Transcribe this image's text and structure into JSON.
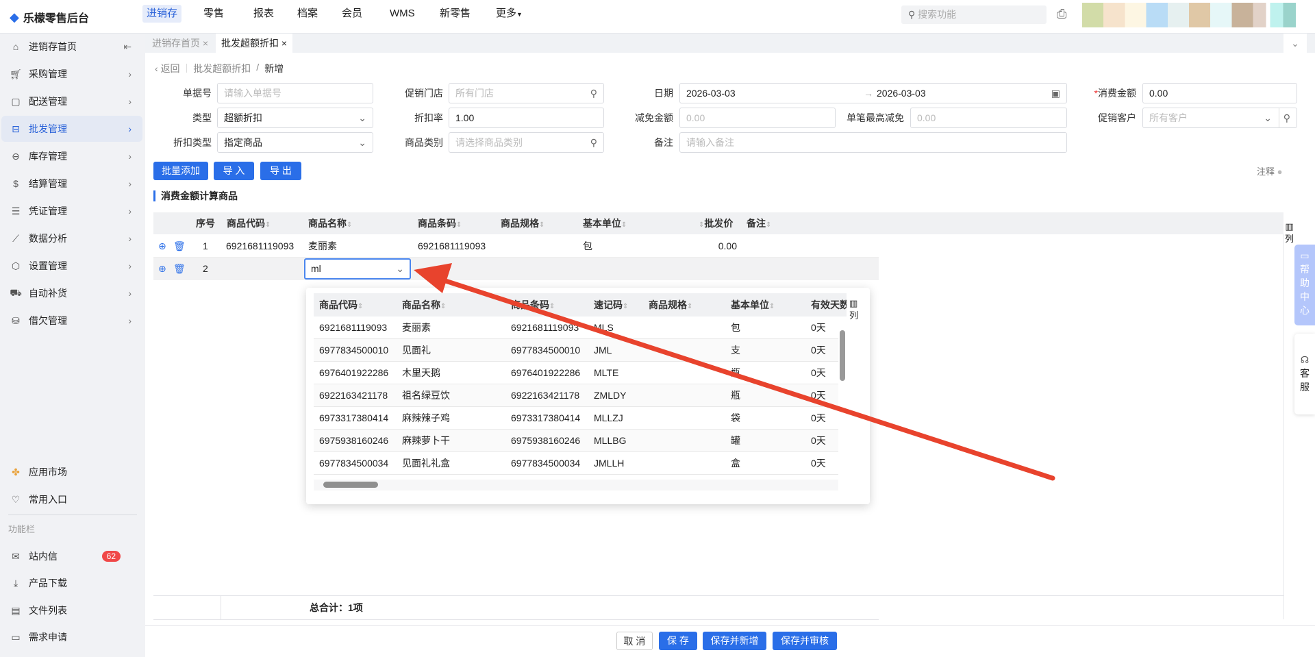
{
  "app": {
    "title": "乐檬零售后台"
  },
  "topnav": [
    {
      "label": "进销存",
      "active": true
    },
    {
      "label": "零售"
    },
    {
      "label": "报表"
    },
    {
      "label": "档案"
    },
    {
      "label": "会员"
    },
    {
      "label": "WMS"
    },
    {
      "label": "新零售"
    },
    {
      "label": "更多"
    }
  ],
  "search": {
    "placeholder": "搜索功能"
  },
  "sidebar": {
    "items": [
      {
        "label": "进销存首页"
      },
      {
        "label": "采购管理"
      },
      {
        "label": "配送管理"
      },
      {
        "label": "批发管理",
        "active": true
      },
      {
        "label": "库存管理"
      },
      {
        "label": "结算管理"
      },
      {
        "label": "凭证管理"
      },
      {
        "label": "数据分析"
      },
      {
        "label": "设置管理"
      },
      {
        "label": "自动补货"
      },
      {
        "label": "借欠管理"
      }
    ],
    "bottom": [
      {
        "label": "应用市场"
      },
      {
        "label": "常用入口"
      }
    ],
    "section_label": "功能栏",
    "tools": [
      {
        "label": "站内信",
        "badge": "62"
      },
      {
        "label": "产品下载"
      },
      {
        "label": "文件列表"
      },
      {
        "label": "需求申请"
      }
    ]
  },
  "tabs": [
    {
      "label": "进销存首页"
    },
    {
      "label": "批发超额折扣",
      "active": true
    }
  ],
  "breadcrumb": {
    "back": "返回",
    "parent": "批发超额折扣",
    "current": "新增"
  },
  "form": {
    "doc_no": {
      "label": "单据号",
      "placeholder": "请输入单据号"
    },
    "store": {
      "label": "促销门店",
      "placeholder": "所有门店"
    },
    "date": {
      "label": "日期",
      "start": "2026-03-03",
      "end": "2026-03-03"
    },
    "amount": {
      "label": "消费金额",
      "value": "0.00",
      "required": "*"
    },
    "type": {
      "label": "类型",
      "value": "超额折扣"
    },
    "rate": {
      "label": "折扣率",
      "value": "1.00"
    },
    "reduce": {
      "label": "减免金额",
      "placeholder": "0.00"
    },
    "max_reduce": {
      "label": "单笔最高减免",
      "placeholder": "0.00"
    },
    "customer": {
      "label": "促销客户",
      "placeholder": "所有客户"
    },
    "discount_type": {
      "label": "折扣类型",
      "value": "指定商品"
    },
    "category": {
      "label": "商品类别",
      "placeholder": "请选择商品类别"
    },
    "remark": {
      "label": "备注",
      "placeholder": "请输入备注"
    }
  },
  "actions": {
    "batch_add": "批量添加",
    "import": "导 入",
    "export": "导 出",
    "notes": "注释"
  },
  "section_title": "消费金额计算商品",
  "table": {
    "headers": [
      "序号",
      "商品代码",
      "商品名称",
      "商品条码",
      "商品规格",
      "基本单位",
      "批发价",
      "备注"
    ],
    "columns_btn": "列",
    "rows": [
      {
        "no": "1",
        "code": "6921681119093",
        "name": "麦丽素",
        "barcode": "6921681119093",
        "spec": "",
        "unit": "包",
        "price": "0.00",
        "remark": ""
      },
      {
        "no": "2",
        "input": "ml"
      }
    ],
    "total": "总合计：1项"
  },
  "dropdown": {
    "headers": [
      "商品代码",
      "商品名称",
      "商品条码",
      "速记码",
      "商品规格",
      "基本单位",
      "有效天数"
    ],
    "columns_btn": "列",
    "rows": [
      [
        "6921681119093",
        "麦丽素",
        "6921681119093",
        "MLS",
        "",
        "包",
        "0天"
      ],
      [
        "6977834500010",
        "见面礼",
        "6977834500010",
        "JML",
        "",
        "支",
        "0天"
      ],
      [
        "6976401922286",
        "木里天鹅",
        "6976401922286",
        "MLTE",
        "",
        "瓶",
        "0天"
      ],
      [
        "6922163421178",
        "祖名绿豆饮",
        "6922163421178",
        "ZMLDY",
        "",
        "瓶",
        "0天"
      ],
      [
        "6973317380414",
        "麻辣辣子鸡",
        "6973317380414",
        "MLLZJ",
        "",
        "袋",
        "0天"
      ],
      [
        "6975938160246",
        "麻辣萝卜干",
        "6975938160246",
        "MLLBG",
        "",
        "罐",
        "0天"
      ],
      [
        "6977834500034",
        "见面礼礼盒",
        "6977834500034",
        "JMLLH",
        "",
        "盒",
        "0天"
      ]
    ]
  },
  "footer": {
    "cancel": "取 消",
    "save": "保 存",
    "save_new": "保存并新增",
    "save_audit": "保存并审核"
  },
  "float": {
    "help": "帮助中心",
    "service": "客服"
  },
  "colors": {
    "primary": "#2a6ee8",
    "arrow": "#e8432d"
  }
}
